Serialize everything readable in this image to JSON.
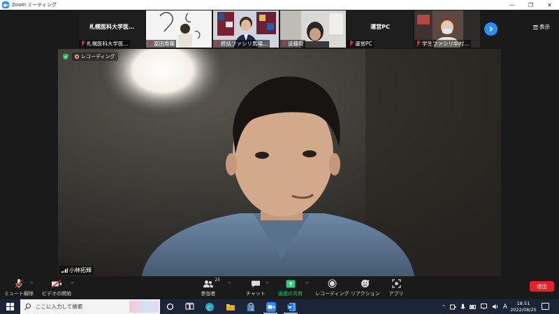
{
  "window": {
    "title": "Zoom ミーティング",
    "controls": [
      "minimize",
      "restore",
      "close"
    ]
  },
  "gallery": {
    "tiles": [
      {
        "big_name": "札幌医科大学医…",
        "label": "札幌医科大学医…",
        "muted": true,
        "video": false
      },
      {
        "label": "冨田寿華",
        "muted": true,
        "video": true
      },
      {
        "label": "統括ファシリ馬場…",
        "muted": true,
        "video": true
      },
      {
        "label": "遠藤舜",
        "muted": true,
        "video": true
      },
      {
        "big_name": "運営PC",
        "label": "運営PC",
        "muted": true,
        "video": false
      },
      {
        "label": "学生ファシリ中村…",
        "muted": true,
        "video": true
      }
    ],
    "next_icon": "chevron-right-icon",
    "view_label": "表示"
  },
  "main_video": {
    "recording_label": "レコーディング",
    "speaker_name": "小林拓輝"
  },
  "toolbar": {
    "unmute_label": "ミュート解除",
    "start_video_label": "ビデオの開始",
    "participants_label": "参加者",
    "participants_count": "25",
    "chat_label": "チャット",
    "share_label": "画面の共有",
    "record_label": "レコーディング",
    "reactions_label": "リアクション",
    "apps_label": "アプリ",
    "leave_label": "退出",
    "colors": {
      "leave": "#d9262c",
      "share": "#24d07a",
      "accent": "#2d8cff"
    }
  },
  "taskbar": {
    "search_placeholder": "ここに入力して検索",
    "apps": [
      "task-view-icon",
      "edge-icon",
      "file-explorer-icon",
      "store-icon",
      "zoom-icon",
      "word-icon"
    ],
    "ime_label": "A",
    "time": "18:51",
    "date": "2022/08/25"
  }
}
